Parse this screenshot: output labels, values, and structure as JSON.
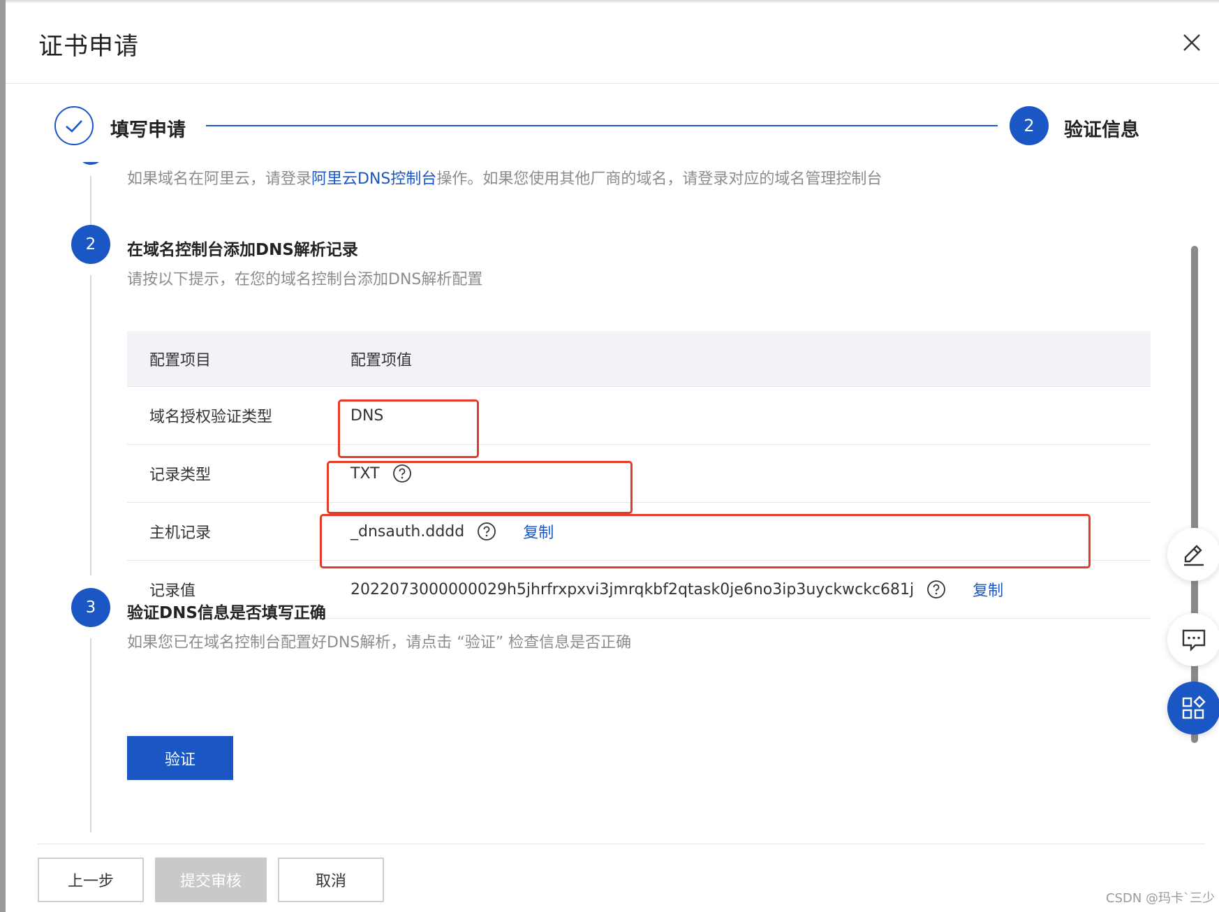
{
  "dialog": {
    "title": "证书申请",
    "close_icon": "close-icon"
  },
  "steps": {
    "step1_label": "填写申请",
    "step2_number": "2",
    "step2_label": "验证信息",
    "done_icon": "check-icon"
  },
  "intro": {
    "desc_prefix": "如果域名在阿里云，请登录",
    "desc_link": "阿里云DNS控制台",
    "desc_suffix": "操作。如果您使用其他厂商的域名，请登录对应的域名管理控制台"
  },
  "section2": {
    "number": "2",
    "title": "在域名控制台添加DNS解析记录",
    "desc": "请按以下提示，在您的域名控制台添加DNS解析配置"
  },
  "table": {
    "headers": [
      "配置项目",
      "配置项值"
    ],
    "rows": [
      {
        "label": "域名授权验证类型",
        "value": "DNS"
      },
      {
        "label": "记录类型",
        "value": "TXT"
      },
      {
        "label": "主机记录",
        "value": "_dnsauth.dddd",
        "copy": "复制"
      },
      {
        "label": "记录值",
        "value": "2022073000000029h5jhrfrxpxvi3jmrqkbf2qtask0je6no3ip3uyckwckc681j",
        "copy": "复制"
      }
    ]
  },
  "section3": {
    "number": "3",
    "title": "验证DNS信息是否填写正确",
    "desc": "如果您已在域名控制台配置好DNS解析，请点击 “验证” 检查信息是否正确",
    "verify_button": "验证"
  },
  "footer": {
    "prev_button": "上一步",
    "submit_button": "提交审核",
    "cancel_button": "取消"
  },
  "side_tools": [
    "edit-icon",
    "feedback-icon",
    "apps-icon"
  ],
  "watermark": "CSDN @玛卡`三少",
  "colors": {
    "primary": "#1a56c4",
    "highlight": "#e43a2b",
    "muted_text": "#8c8c8c"
  }
}
